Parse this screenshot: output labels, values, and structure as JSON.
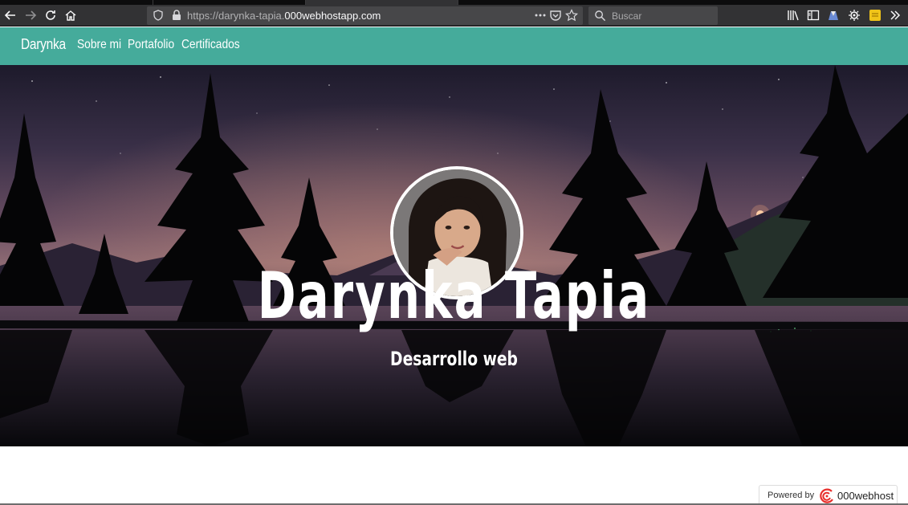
{
  "browser": {
    "url_prefix": "https://darynka-tapia.",
    "url_host": "000webhostapp.com",
    "search_placeholder": "Buscar"
  },
  "navbar": {
    "brand": "Darynka",
    "links": [
      "Sobre mi",
      "Portafolio",
      "Certificados"
    ],
    "background": "#45ab9b"
  },
  "hero": {
    "title": "Darynka Tapia",
    "subtitle": "Desarrollo web"
  },
  "footer_badge": {
    "label": "Powered by",
    "brand": "000webhost"
  },
  "icons": [
    "back-icon",
    "forward-icon",
    "reload-icon",
    "home-icon",
    "shield-icon",
    "lock-icon",
    "more-icon",
    "pocket-icon",
    "bookmark-star-icon",
    "search-icon",
    "library-icon",
    "sidebar-icon",
    "extension-icon",
    "settings-icon",
    "overflow-icon"
  ]
}
